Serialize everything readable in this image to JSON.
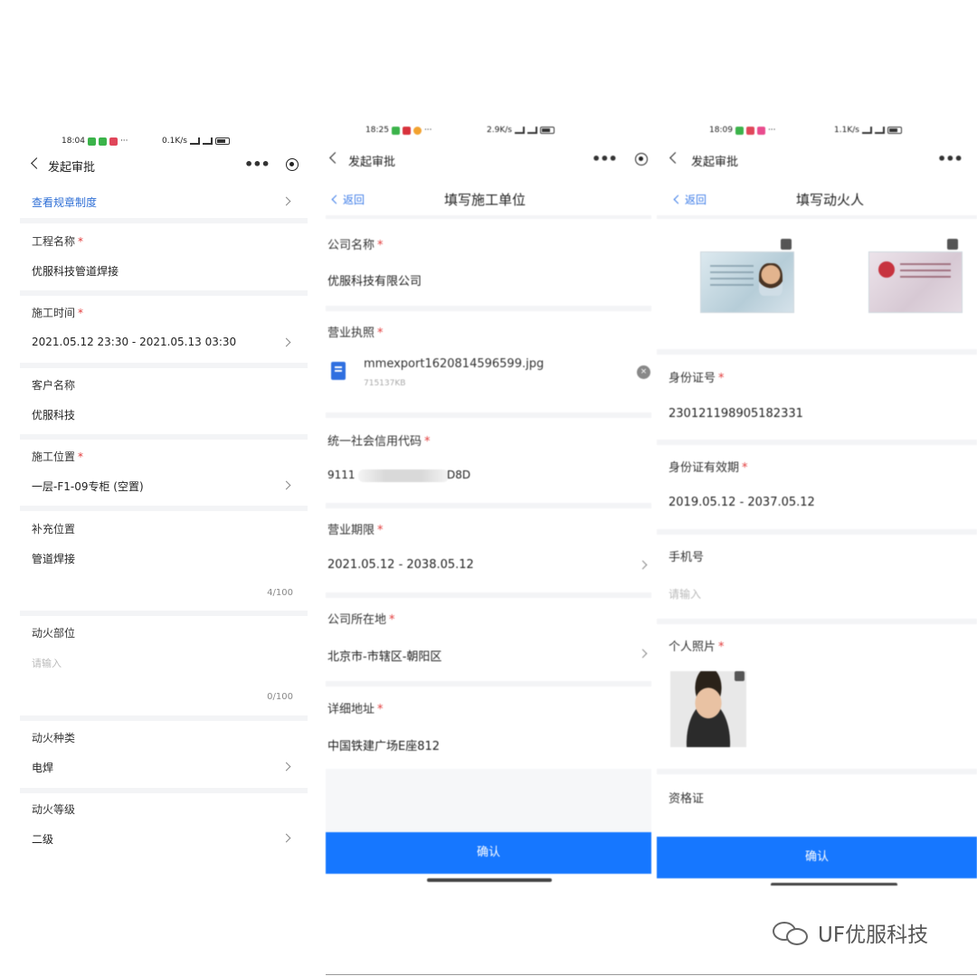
{
  "screen1": {
    "status": {
      "time": "18:04",
      "dots": "···",
      "speed": "0.1K/s"
    },
    "nav": {
      "title": "发起审批"
    },
    "rules_link": "查看规章制度",
    "fields": [
      {
        "label": "工程名称",
        "required": "*",
        "value": "优服科技管道焊接"
      },
      {
        "label": "施工时间",
        "required": "*",
        "value": "2021.05.12 23:30 - 2021.05.13 03:30"
      },
      {
        "label": "客户名称",
        "value": "优服科技"
      },
      {
        "label": "施工位置",
        "required": "*",
        "value": "一层-F1-09专柜 (空置)"
      },
      {
        "label": "补充位置",
        "value": "管道焊接",
        "counter": "4/100"
      },
      {
        "label": "动火部位",
        "placeholder": "请输入",
        "counter": "0/100"
      },
      {
        "label": "动火种类",
        "value": "电焊"
      },
      {
        "label": "动火等级",
        "value": "二级"
      }
    ]
  },
  "screen2": {
    "status": {
      "time": "18:25",
      "dots": "···",
      "speed": "2.9K/s"
    },
    "nav": {
      "title": "发起审批"
    },
    "back_label": "返回",
    "subtitle": "填写施工单位",
    "fields": [
      {
        "label": "公司名称",
        "required": "*",
        "value": "优服科技有限公司"
      },
      {
        "label": "营业执照",
        "required": "*"
      },
      {
        "label": "统一社会信用代码",
        "required": "*",
        "value_prefix": "9111",
        "value_suffix": "D8D"
      },
      {
        "label": "营业期限",
        "required": "*",
        "value": "2021.05.12 - 2038.05.12"
      },
      {
        "label": "公司所在地",
        "required": "*",
        "value": "北京市-市辖区-朝阳区"
      },
      {
        "label": "详细地址",
        "required": "*",
        "value": "中国铁建广场E座812"
      }
    ],
    "file": {
      "name": "mmexport1620814596599.jpg",
      "size": "715137KB",
      "remove_glyph": "×"
    },
    "confirm_label": "确认"
  },
  "screen3": {
    "status": {
      "time": "18:09",
      "dots": "···",
      "speed": "1.1K/s"
    },
    "nav": {
      "title": "发起审批"
    },
    "back_label": "返回",
    "subtitle": "填写动火人",
    "fields": [
      {
        "label": "身份证号",
        "required": "*",
        "value": "230121198905182331"
      },
      {
        "label": "身份证有效期",
        "required": "*",
        "value": "2019.05.12 - 2037.05.12"
      },
      {
        "label": "手机号",
        "placeholder": "请输入"
      },
      {
        "label": "个人照片",
        "required": "*"
      },
      {
        "label": "资格证"
      }
    ],
    "confirm_label": "确认"
  },
  "watermark": {
    "text": "UF优服科技"
  },
  "colors": {
    "accent": "#1677ff",
    "link": "#3b7be8",
    "required": "#e23b3b",
    "divider": "#f3f4f6"
  }
}
